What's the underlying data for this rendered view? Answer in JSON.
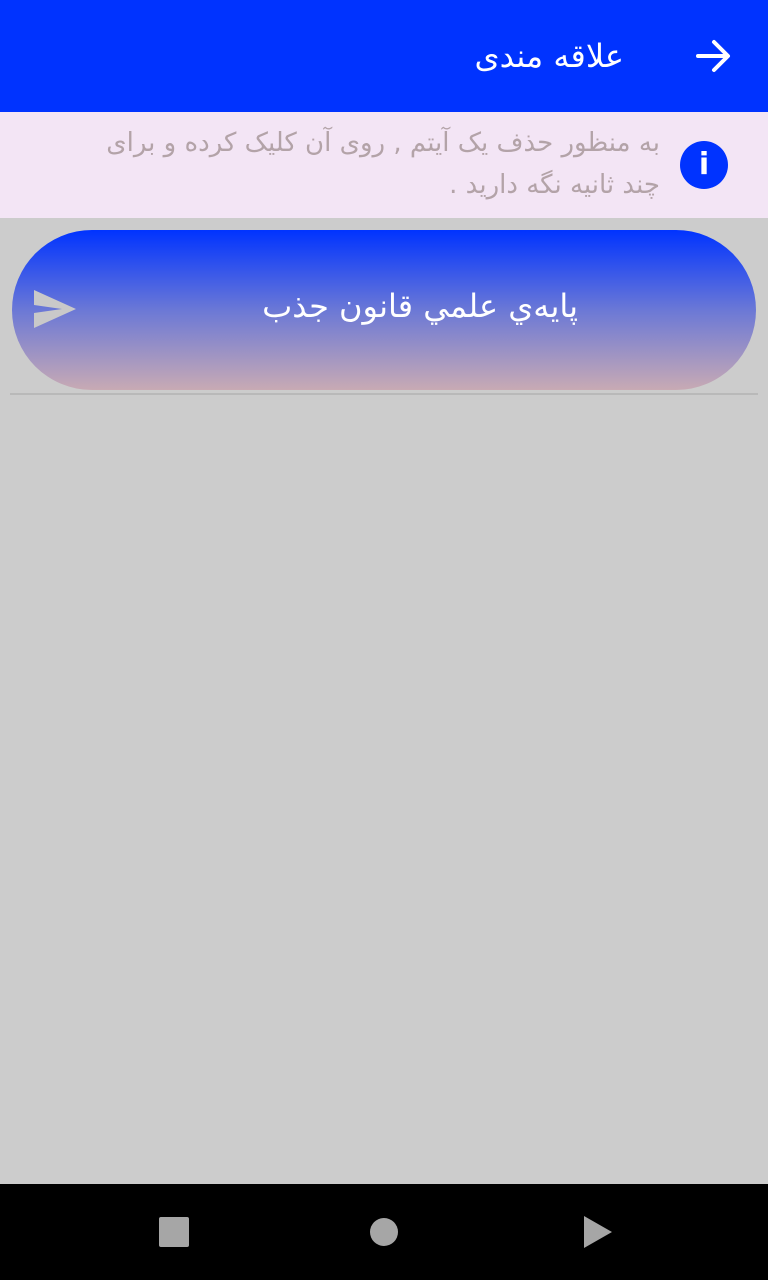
{
  "app_bar": {
    "title": "علاقه مندی",
    "back_icon": "arrow-right-icon",
    "color": "#0033ff"
  },
  "info_banner": {
    "icon": "info-icon",
    "icon_glyph": "i",
    "message": "به منظور حذف یک آیتم , روی آن کلیک کرده و برای چند ثانیه نگه دارید ."
  },
  "favorites": [
    {
      "label": "پايه‌ي علمي قانون جذب",
      "icon": "send-icon"
    }
  ],
  "nav_bar": {
    "buttons": [
      "recents-square-icon",
      "home-circle-icon",
      "back-triangle-icon"
    ]
  }
}
